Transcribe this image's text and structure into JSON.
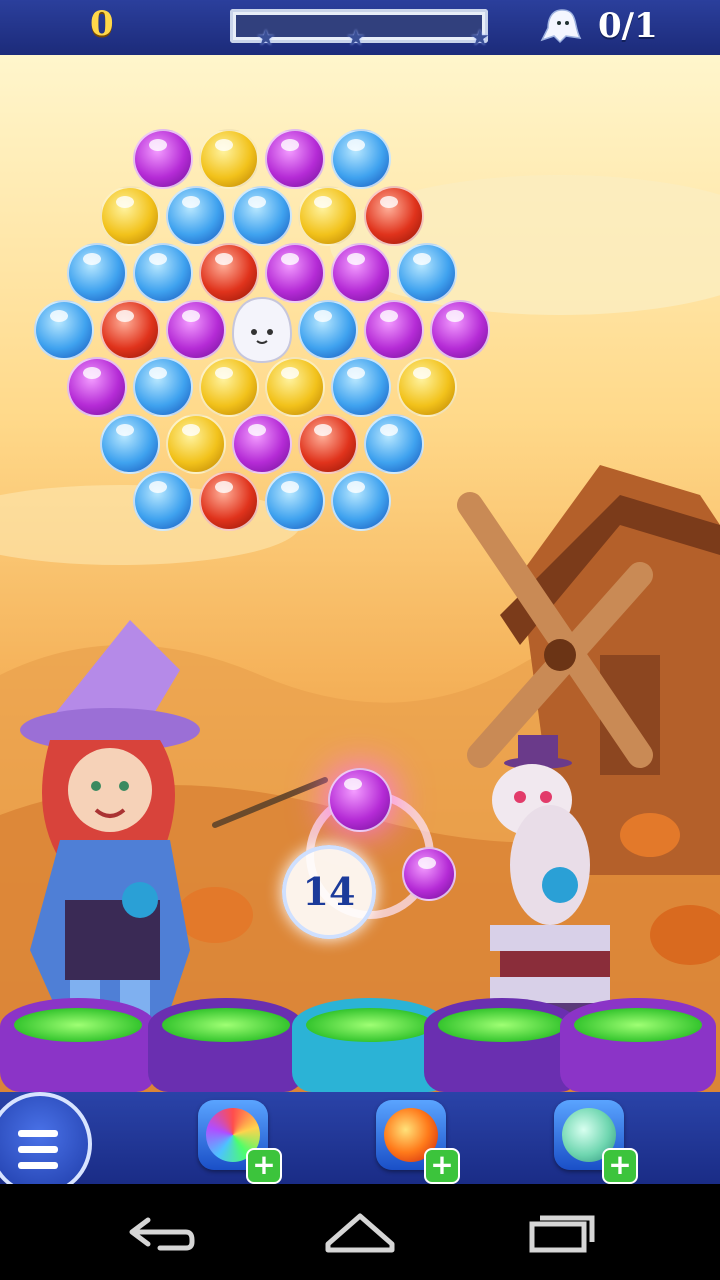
{
  "hud": {
    "score": "0",
    "ghost_counter": "0/1",
    "stars": [
      "star",
      "star",
      "star"
    ]
  },
  "game": {
    "shots_remaining": "14",
    "current_bubble": "purple",
    "next_bubble": "purple",
    "colors": {
      "purple": "#b52bd6",
      "yellow": "#f2c21b",
      "blue": "#3fa2ef",
      "red": "#e0331c"
    },
    "grid": [
      [
        "purple",
        "yellow",
        "purple",
        "blue"
      ],
      [
        "yellow",
        "blue",
        "blue",
        "yellow",
        "red"
      ],
      [
        "blue",
        "blue",
        "red",
        "purple",
        "purple",
        "blue"
      ],
      [
        "blue",
        "red",
        "purple",
        "ghost",
        "blue",
        "purple",
        "purple"
      ],
      [
        "purple",
        "blue",
        "yellow",
        "yellow",
        "blue",
        "yellow"
      ],
      [
        "blue",
        "yellow",
        "purple",
        "red",
        "blue"
      ],
      [
        "blue",
        "red",
        "blue",
        "blue"
      ]
    ]
  },
  "boosters": [
    {
      "name": "rainbow-booster-icon"
    },
    {
      "name": "fireball-booster-icon"
    },
    {
      "name": "wand-booster-icon"
    }
  ],
  "nav": [
    "back-icon",
    "home-icon",
    "recents-icon"
  ]
}
